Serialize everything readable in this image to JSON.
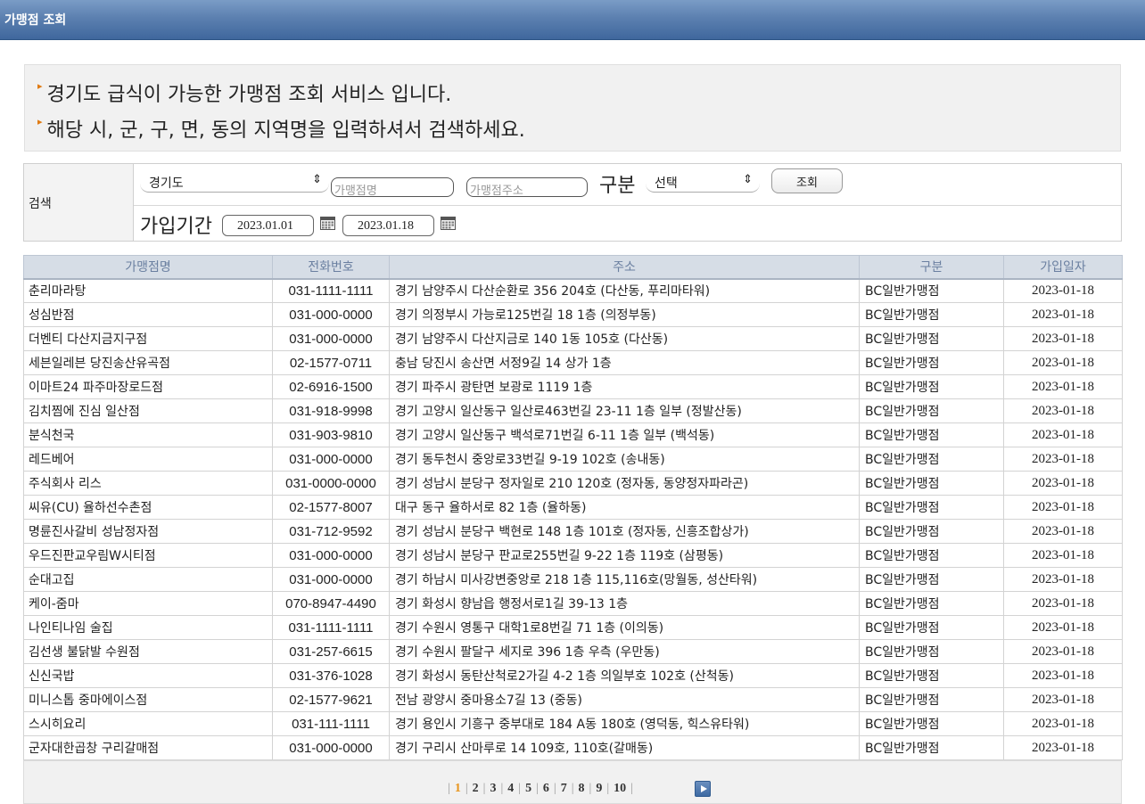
{
  "window": {
    "title": "가맹점 조회"
  },
  "notice": {
    "line1": "경기도 급식이 가능한 가맹점 조회 서비스 입니다.",
    "line2": "해당 시, 군, 구, 면, 동의 지역명을 입력하셔서 검색하세요."
  },
  "search": {
    "label": "검색",
    "region_select": "경기도",
    "store_name_placeholder": "가맹점명",
    "store_address_placeholder": "가맹점주소",
    "category_label": "구분",
    "category_select": "선택",
    "search_button": "조회",
    "period_label": "가입기간",
    "date_from": "2023.01.01",
    "date_to": "2023.01.18"
  },
  "table": {
    "headers": [
      "가맹점명",
      "전화번호",
      "주소",
      "구분",
      "가입일자"
    ],
    "rows": [
      [
        "춘리마라탕",
        "031-1111-1111",
        "경기 남양주시 다산순환로 356 204호 (다산동, 푸리마타워)",
        "BC일반가맹점",
        "2023-01-18"
      ],
      [
        "성심반점",
        "031-000-0000",
        "경기 의정부시 가능로125번길 18 1층 (의정부동)",
        "BC일반가맹점",
        "2023-01-18"
      ],
      [
        "더벤티 다산지금지구점",
        "031-000-0000",
        "경기 남양주시 다산지금로 140 1동 105호 (다산동)",
        "BC일반가맹점",
        "2023-01-18"
      ],
      [
        "세븐일레븐 당진송산유곡점",
        "02-1577-0711",
        "충남 당진시 송산면 서정9길 14 상가 1층",
        "BC일반가맹점",
        "2023-01-18"
      ],
      [
        "이마트24 파주마장로드점",
        "02-6916-1500",
        "경기 파주시 광탄면 보광로 1119 1층",
        "BC일반가맹점",
        "2023-01-18"
      ],
      [
        "김치찜에 진심 일산점",
        "031-918-9998",
        "경기 고양시 일산동구 일산로463번길 23-11 1층 일부 (정발산동)",
        "BC일반가맹점",
        "2023-01-18"
      ],
      [
        "분식천국",
        "031-903-9810",
        "경기 고양시 일산동구 백석로71번길 6-11 1층 일부 (백석동)",
        "BC일반가맹점",
        "2023-01-18"
      ],
      [
        "레드베어",
        "031-000-0000",
        "경기 동두천시 중앙로33번길 9-19 102호 (송내동)",
        "BC일반가맹점",
        "2023-01-18"
      ],
      [
        "주식회사 리스",
        "031-0000-0000",
        "경기 성남시 분당구 정자일로 210 120호 (정자동, 동양정자파라곤)",
        "BC일반가맹점",
        "2023-01-18"
      ],
      [
        "씨유(CU) 율하선수촌점",
        "02-1577-8007",
        "대구 동구 율하서로 82 1층 (율하동)",
        "BC일반가맹점",
        "2023-01-18"
      ],
      [
        "명륜진사갈비 성남정자점",
        "031-712-9592",
        "경기 성남시 분당구 백현로 148 1층 101호 (정자동, 신흥조합상가)",
        "BC일반가맹점",
        "2023-01-18"
      ],
      [
        "우드진판교우림W시티점",
        "031-000-0000",
        "경기 성남시 분당구 판교로255번길 9-22 1층 119호 (삼평동)",
        "BC일반가맹점",
        "2023-01-18"
      ],
      [
        "순대고집",
        "031-000-0000",
        "경기 하남시 미사강변중앙로 218 1층 115,116호(망월동, 성산타워)",
        "BC일반가맹점",
        "2023-01-18"
      ],
      [
        "케이-줌마",
        "070-8947-4490",
        "경기 화성시 향남읍 행정서로1길 39-13 1층",
        "BC일반가맹점",
        "2023-01-18"
      ],
      [
        "나인티나임 술집",
        "031-1111-1111",
        "경기 수원시 영통구 대학1로8번길 71 1층 (이의동)",
        "BC일반가맹점",
        "2023-01-18"
      ],
      [
        "김선생 불닭발 수원점",
        "031-257-6615",
        "경기 수원시 팔달구 세지로 396 1층 우측 (우만동)",
        "BC일반가맹점",
        "2023-01-18"
      ],
      [
        "신신국밥",
        "031-376-1028",
        "경기 화성시 동탄산척로2가길 4-2 1층 의일부호 102호 (산척동)",
        "BC일반가맹점",
        "2023-01-18"
      ],
      [
        "미니스톱 중마에이스점",
        "02-1577-9621",
        "전남 광양시 중마용소7길 13 (중동)",
        "BC일반가맹점",
        "2023-01-18"
      ],
      [
        "스시히요리",
        "031-111-1111",
        "경기 용인시 기흥구 중부대로 184 A동 180호 (영덕동, 힉스유타워)",
        "BC일반가맹점",
        "2023-01-18"
      ],
      [
        "군자대한곱창 구리갈매점",
        "031-000-0000",
        "경기 구리시 산마루로 14 109호, 110호(갈매동)",
        "BC일반가맹점",
        "2023-01-18"
      ]
    ]
  },
  "pagination": {
    "current": "1",
    "pages": [
      "1",
      "2",
      "3",
      "4",
      "5",
      "6",
      "7",
      "8",
      "9",
      "10"
    ]
  },
  "colors": {
    "titlebar": "#5c80b0",
    "header_bg": "#d6dde6",
    "current_page": "#e8941a",
    "notice_bullet": "#e07a12"
  }
}
